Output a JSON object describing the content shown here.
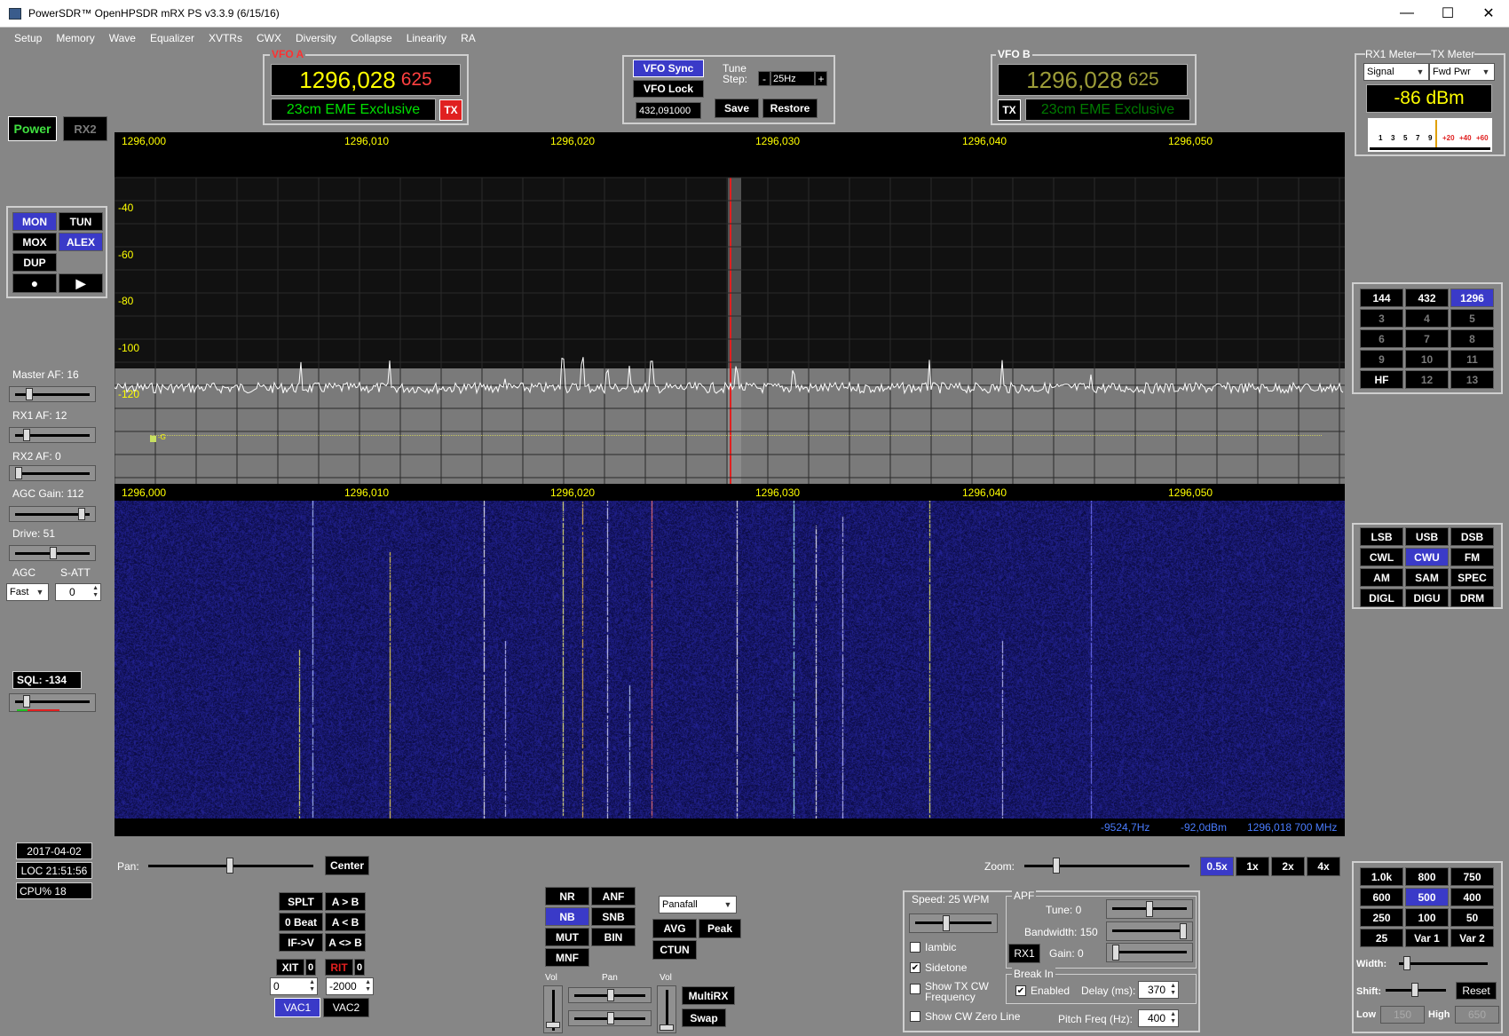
{
  "window": {
    "title": "PowerSDR™ OpenHPSDR mRX PS v3.3.9 (6/15/16)",
    "minimize": "—",
    "maximize": "☐",
    "close": "✕"
  },
  "menu": [
    "Setup",
    "Memory",
    "Wave",
    "Equalizer",
    "XVTRs",
    "CWX",
    "Diversity",
    "Collapse",
    "Linearity",
    "RA"
  ],
  "vfoA": {
    "label": "VFO A",
    "freq_main": "1296,028",
    "freq_sub": "625",
    "band_text": "23cm EME Exclusive",
    "tx": "TX"
  },
  "vfoB": {
    "label": "VFO B",
    "freq_main": "1296,028",
    "freq_sub": "625",
    "band_text": "23cm EME Exclusive",
    "tx": "TX"
  },
  "sync": {
    "vfo_sync": "VFO Sync",
    "vfo_lock": "VFO Lock",
    "tune_step_label": "Tune Step:",
    "minus": "-",
    "step": "25Hz",
    "plus": "+",
    "freq_readout": "432,091000",
    "save": "Save",
    "restore": "Restore"
  },
  "meter": {
    "rx_label": "RX1 Meter",
    "tx_label": "TX Meter",
    "rx_mode": "Signal",
    "tx_mode": "Fwd Pwr",
    "reading": "-86 dBm",
    "scale": [
      "1",
      "3",
      "5",
      "7",
      "9",
      "+20",
      "+40",
      "+60"
    ]
  },
  "power": {
    "power": "Power",
    "rx2": "RX2"
  },
  "control": {
    "mon": "MON",
    "tun": "TUN",
    "mox": "MOX",
    "alex": "ALEX",
    "dup": "DUP",
    "record": "●",
    "play": "▶"
  },
  "audio": {
    "master_af": "Master AF:  16",
    "master_af_value": 0.16,
    "rx1_af": "RX1 AF:  12",
    "rx1_af_value": 0.12,
    "rx2_af": "RX2 AF:  0",
    "rx2_af_value": 0.0,
    "agc_gain": "AGC Gain:  112",
    "agc_gain_value": 0.93,
    "drive": "Drive:  51",
    "drive_value": 0.51,
    "agc": "AGC",
    "satt": "S-ATT",
    "agc_mode": "Fast",
    "satt_value": "0",
    "sql": "SQL: -134",
    "sql_value": 0.12
  },
  "status": {
    "date": "2017-04-02",
    "time": "LOC 21:51:56",
    "cpu": "CPU%  18"
  },
  "panadapter": {
    "freq_labels": [
      "1296,000",
      "1296,010",
      "1296,020",
      "1296,030",
      "1296,040",
      "1296,050"
    ],
    "db_labels": [
      "-40",
      "-60",
      "-80",
      "-100",
      "-120"
    ],
    "marker": "-G",
    "readout_offset": "-9524,7Hz",
    "readout_dbm": "-92,0dBm",
    "readout_freq": "1296,018 700 MHz"
  },
  "pan": {
    "label": "Pan:",
    "value": 0.5,
    "center": "Center"
  },
  "zoom": {
    "label": "Zoom:",
    "value": 0.18,
    "buttons": [
      "0.5x",
      "1x",
      "2x",
      "4x"
    ]
  },
  "bands": [
    {
      "t": "144",
      "s": "n"
    },
    {
      "t": "432",
      "s": "n"
    },
    {
      "t": "1296",
      "s": "on"
    },
    {
      "t": "3",
      "s": "dim"
    },
    {
      "t": "4",
      "s": "dim"
    },
    {
      "t": "5",
      "s": "dim"
    },
    {
      "t": "6",
      "s": "dim"
    },
    {
      "t": "7",
      "s": "dim"
    },
    {
      "t": "8",
      "s": "dim"
    },
    {
      "t": "9",
      "s": "dim"
    },
    {
      "t": "10",
      "s": "dim"
    },
    {
      "t": "11",
      "s": "dim"
    },
    {
      "t": "HF",
      "s": "n"
    },
    {
      "t": "12",
      "s": "dim"
    },
    {
      "t": "13",
      "s": "dim"
    }
  ],
  "modes": [
    {
      "t": "LSB",
      "s": "n"
    },
    {
      "t": "USB",
      "s": "n"
    },
    {
      "t": "DSB",
      "s": "n"
    },
    {
      "t": "CWL",
      "s": "n"
    },
    {
      "t": "CWU",
      "s": "on"
    },
    {
      "t": "FM",
      "s": "n"
    },
    {
      "t": "AM",
      "s": "n"
    },
    {
      "t": "SAM",
      "s": "n"
    },
    {
      "t": "SPEC",
      "s": "n"
    },
    {
      "t": "DIGL",
      "s": "n"
    },
    {
      "t": "DIGU",
      "s": "n"
    },
    {
      "t": "DRM",
      "s": "n"
    }
  ],
  "filters": [
    {
      "t": "1.0k",
      "s": "n"
    },
    {
      "t": "800",
      "s": "n"
    },
    {
      "t": "750",
      "s": "n"
    },
    {
      "t": "600",
      "s": "n"
    },
    {
      "t": "500",
      "s": "on"
    },
    {
      "t": "400",
      "s": "n"
    },
    {
      "t": "250",
      "s": "n"
    },
    {
      "t": "100",
      "s": "n"
    },
    {
      "t": "50",
      "s": "n"
    },
    {
      "t": "25",
      "s": "n"
    },
    {
      "t": "Var 1",
      "s": "n"
    },
    {
      "t": "Var 2",
      "s": "n"
    }
  ],
  "filter_ctrl": {
    "width": "Width:",
    "width_value": 0.05,
    "shift": "Shift:",
    "shift_value": 0.5,
    "reset": "Reset",
    "low": "Low",
    "low_value": "150",
    "high": "High",
    "high_value": "650"
  },
  "split": {
    "splt": "SPLT",
    "a_to_b": "A > B",
    "zero_beat": "0 Beat",
    "a_from_b": "A < B",
    "if_v": "IF->V",
    "a_swap_b": "A <> B",
    "xit": "XIT",
    "xit_count": "0",
    "rit": "RIT",
    "rit_count": "0",
    "xit_value": "0",
    "rit_value": "-2000",
    "vac1": "VAC1",
    "vac2": "VAC2"
  },
  "dsp": {
    "nr": "NR",
    "anf": "ANF",
    "nb": "NB",
    "snb": "SNB",
    "mut": "MUT",
    "bin": "BIN",
    "mnf": "MNF",
    "display_mode": "Panafall",
    "avg": "AVG",
    "peak": "Peak",
    "ctun": "CTUN",
    "vol": "Vol",
    "pan": "Pan",
    "vol2": "Vol",
    "multirx": "MultiRX",
    "swap": "Swap"
  },
  "cw": {
    "speed": "Speed:  25 WPM",
    "speed_value": 0.4,
    "iambic": "Iambic",
    "iambic_checked": false,
    "sidetone": "Sidetone",
    "sidetone_checked": true,
    "show_tx_cw": "Show TX CW Frequency",
    "show_tx_cw_checked": false,
    "show_zero": "Show CW Zero Line",
    "show_zero_checked": false,
    "apf": "APF",
    "apf_tune": "Tune:  0",
    "apf_tune_value": 0.5,
    "apf_bw": "Bandwidth:  150",
    "apf_bw_value": 1.0,
    "rx1": "RX1",
    "apf_gain": "Gain:  0",
    "apf_gain_value": 0.0,
    "break_in": "Break In",
    "enabled": "Enabled",
    "enabled_checked": true,
    "delay": "Delay (ms):",
    "delay_value": "370",
    "pitch": "Pitch Freq (Hz):",
    "pitch_value": "400"
  },
  "colors": {
    "bg": "#868686",
    "active": "#3a3ac8",
    "vfoA_text": "#ffff00",
    "vfoA_sub": "#ff4040",
    "vfoB_text": "#9c9c38",
    "band_green": "#00e000",
    "readout_blue": "#4a7cff",
    "tx_red": "#e02020"
  }
}
